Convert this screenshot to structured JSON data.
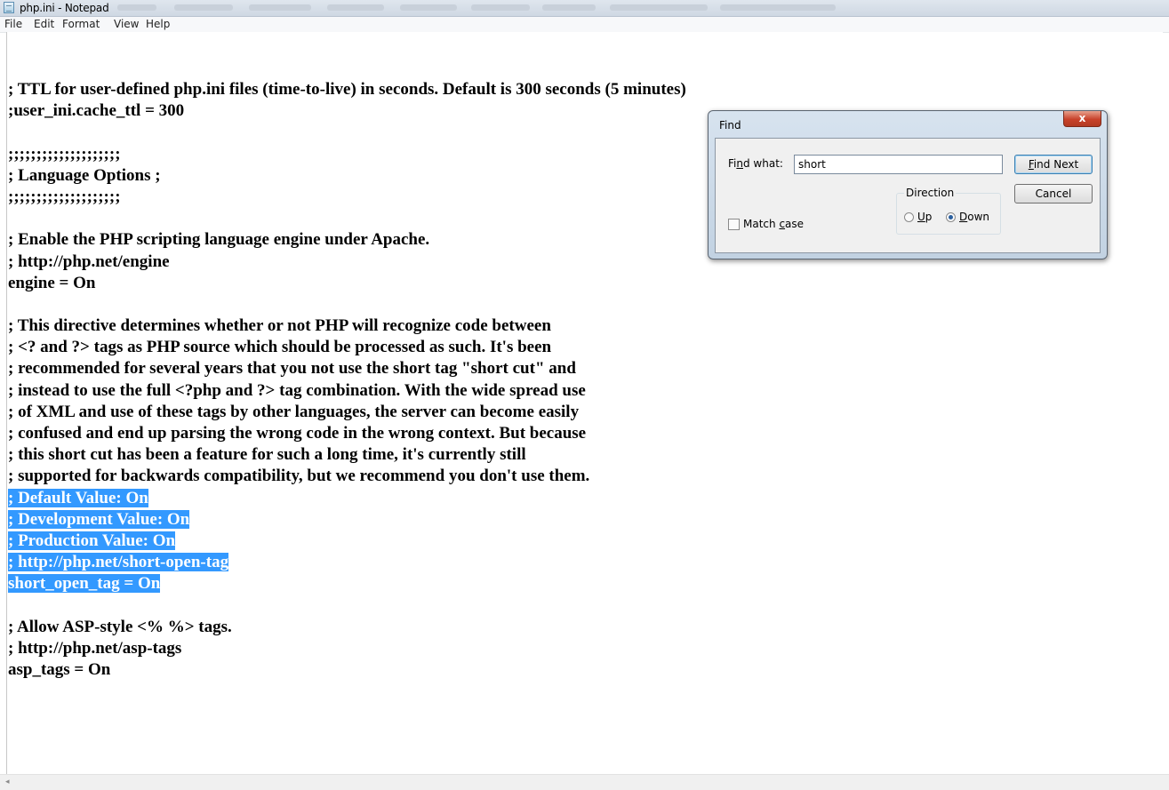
{
  "window": {
    "title": "php.ini - Notepad"
  },
  "menu": [
    "File",
    "Edit",
    "Format",
    "View",
    "Help"
  ],
  "editor": {
    "lines": [
      "; TTL for user-defined php.ini files (time-to-live) in seconds. Default is 300 seconds (5 minutes)",
      ";user_ini.cache_ttl = 300",
      "",
      ";;;;;;;;;;;;;;;;;;;;",
      "; Language Options ;",
      ";;;;;;;;;;;;;;;;;;;;",
      "",
      "; Enable the PHP scripting language engine under Apache.",
      "; http://php.net/engine",
      "engine = On",
      "",
      "; This directive determines whether or not PHP will recognize code between",
      "; <? and ?> tags as PHP source which should be processed as such. It's been",
      "; recommended for several years that you not use the short tag \"short cut\" and",
      "; instead to use the full <?php and ?> tag combination. With the wide spread use",
      "; of XML and use of these tags by other languages, the server can become easily",
      "; confused and end up parsing the wrong code in the wrong context. But because",
      "; this short cut has been a feature for such a long time, it's currently still",
      "; supported for backwards compatibility, but we recommend you don't use them.",
      "; Default Value: On",
      "; Development Value: On",
      "; Production Value: On",
      "; http://php.net/short-open-tag",
      "short_open_tag = On",
      "",
      "; Allow ASP-style <% %> tags.",
      "; http://php.net/asp-tags",
      "asp_tags = On"
    ],
    "selected_line_indices": [
      19,
      20,
      21,
      22,
      23
    ]
  },
  "find_dialog": {
    "title": "Find",
    "close_label": "x",
    "find_what_label_prefix": "Fi",
    "find_what_label_hotkey": "n",
    "find_what_label_suffix": "d what:",
    "search_value": "short",
    "find_next_label": "Find Next",
    "find_next_hotkey": "F",
    "find_next_rest": "ind Next",
    "cancel_label": "Cancel",
    "direction_label": "Direction",
    "up_label": "Up",
    "up_hotkey": "U",
    "up_rest": "p",
    "down_label": "Down",
    "down_hotkey": "D",
    "down_rest": "own",
    "direction_selected": "Down",
    "match_case_prefix": "Match ",
    "match_case_hotkey": "c",
    "match_case_rest": "ase",
    "match_case_checked": false
  },
  "icons": {
    "app": "notepad-icon",
    "close": "close-icon",
    "scroll_left": "scroll-left-arrow-icon"
  },
  "colors": {
    "selection": "#3399ff",
    "close_button": "#c8422a"
  },
  "scrollbar": {
    "left_arrow": "◂"
  }
}
